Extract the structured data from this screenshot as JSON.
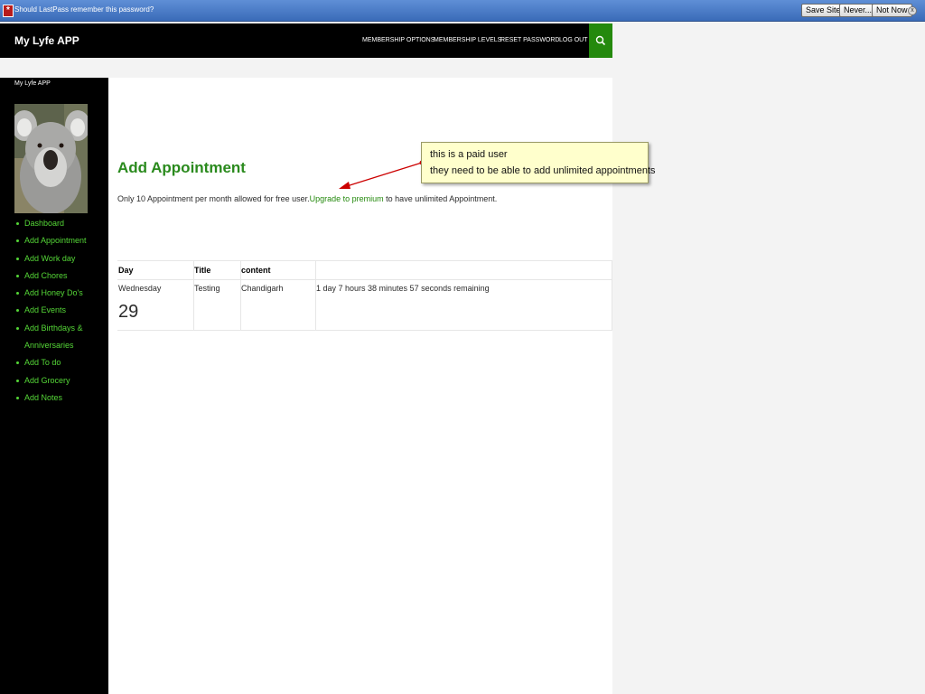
{
  "lastpass": {
    "message": "Should LastPass remember this password?",
    "save_site": "Save Site",
    "never": "Never...",
    "not_now": "Not Now",
    "close": "x"
  },
  "header": {
    "site_title": "My Lyfe APP",
    "nav": [
      "MEMBERSHIP OPTIONS",
      "MEMBERSHIP LEVELS",
      "RESET PASSWORD",
      "LOG OUT"
    ],
    "search_icon": "search-icon"
  },
  "sidebar": {
    "title": "My Lyfe APP",
    "items": [
      "Dashboard",
      "Add Appointment",
      "Add Work day",
      "Add Chores",
      "Add Honey Do's",
      "Add Events",
      "Add Birthdays & Anniversaries",
      "Add To do",
      "Add Grocery",
      "Add Notes"
    ]
  },
  "main": {
    "heading": "Add Appointment",
    "info_prefix": "Only 10 Appointment per month allowed for free user.",
    "upgrade_link": "Upgrade to premium",
    "info_suffix": " to have unlimited Appointment.",
    "table": {
      "headers": [
        "Day",
        "Title",
        "content",
        ""
      ],
      "row": {
        "day_name": "Wednesday",
        "day_number": "29",
        "title": "Testing",
        "content": "Chandigarh",
        "remaining": "1 day 7 hours 38 minutes 57 seconds remaining"
      }
    }
  },
  "annotation": {
    "line1": "this is a paid user",
    "line2": "they need to be able to add unlimited appointments"
  },
  "colors": {
    "accent": "#24890d",
    "link_green": "#55d737",
    "lastpass_blue": "#3a6bb8",
    "callout_bg": "#ffffcc",
    "arrow_red": "#cc0000"
  }
}
